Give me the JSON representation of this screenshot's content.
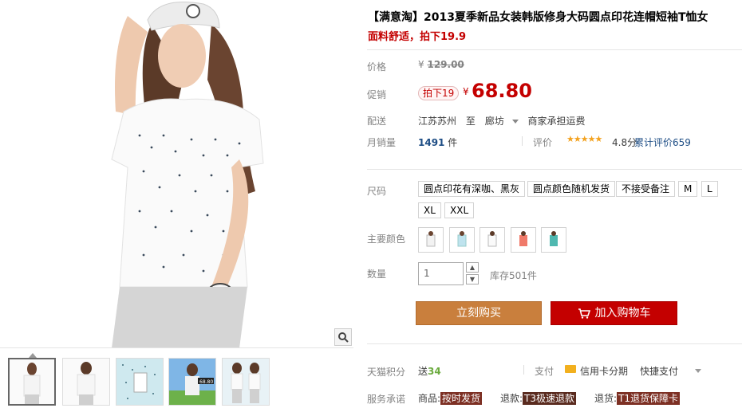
{
  "product": {
    "title": "【满意淘】2013夏季新品女装韩版修身大码圆点印花连帽短袖T恤女",
    "subtitle": "面料舒适，拍下19.9"
  },
  "price": {
    "label": "价格",
    "currency": "¥",
    "original": "129.00"
  },
  "promo": {
    "label": "促销",
    "badge": "拍下19",
    "currency": "¥",
    "price": "68.80"
  },
  "shipping": {
    "label": "配送",
    "from": "江苏苏州",
    "to_word": "至",
    "to": "廊坊",
    "note": "商家承担运费"
  },
  "sales": {
    "label": "月销量",
    "count": "1491",
    "unit": "件",
    "rating_label": "评价",
    "stars": "★★★★★",
    "score": "4.8分",
    "review_link": "累计评价659"
  },
  "size": {
    "label": "尺码",
    "options": [
      "圆点印花有深咖、黑灰",
      "圆点颜色随机发货",
      "不接受备注",
      "M",
      "L",
      "XL",
      "XXL"
    ]
  },
  "color": {
    "label": "主要颜色",
    "swatch_colors": [
      "#f4f4f4",
      "#bfe3ee",
      "#f2f2f2",
      "#f07a6a",
      "#4fb8b0"
    ]
  },
  "quantity": {
    "label": "数量",
    "value": "1",
    "up": "▲",
    "down": "▼",
    "stock": "库存501件"
  },
  "actions": {
    "buy": "立刻购买",
    "cart": "加入购物车"
  },
  "services": {
    "points_label": "天猫积分",
    "points_prefix": "送",
    "points_value": "34",
    "pay_label": "支付",
    "credit": "信用卡分期",
    "quick": "快捷支付",
    "promise_label": "服务承诺",
    "goods_label": "商品:",
    "goods_tag": "按时发货",
    "refund_label": "退款:",
    "refund_tag": "T3极速退款",
    "return_label": "退货:",
    "return_tag": "T1退货保障卡"
  },
  "gallery": {
    "thumb_badge": "68.80"
  },
  "colors": {
    "accent_red": "#c40000",
    "buy_orange": "#c97f3d",
    "link_blue": "#1c4c84"
  }
}
